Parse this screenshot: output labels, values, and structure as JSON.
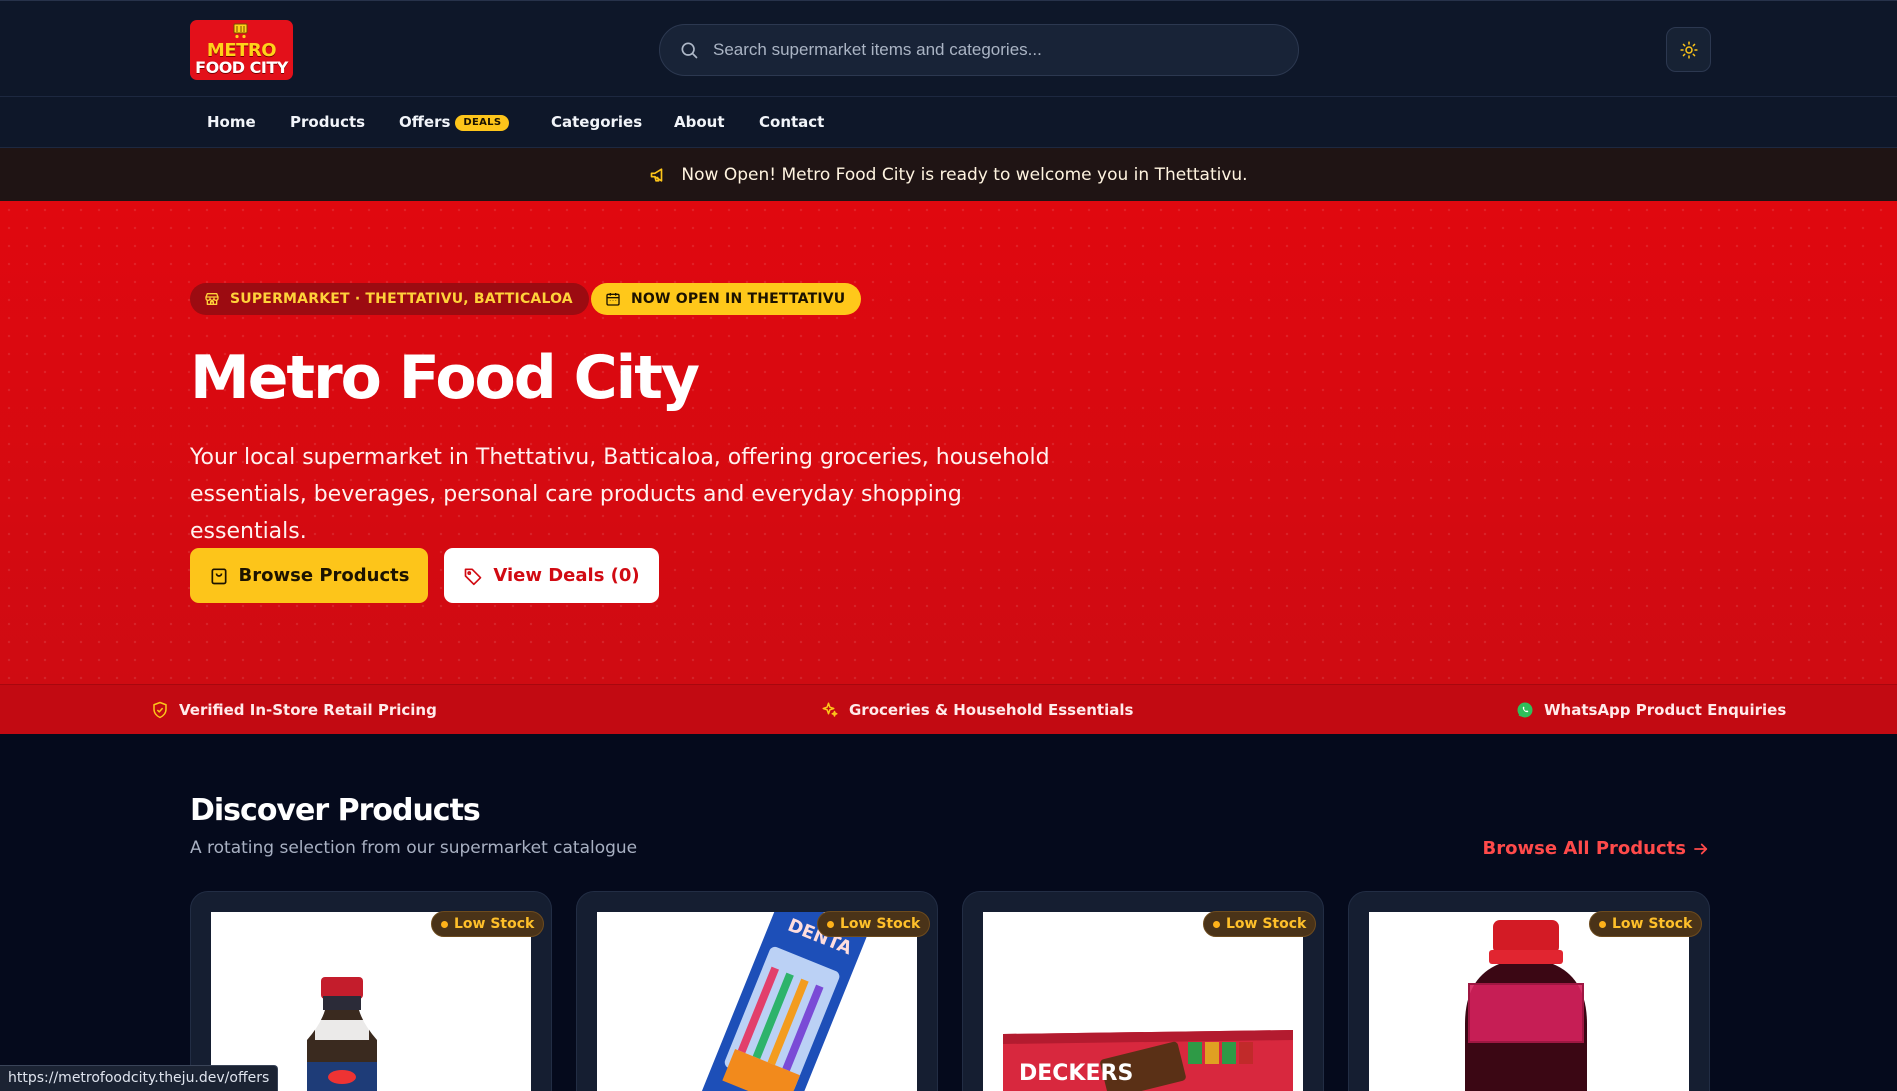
{
  "header": {
    "logo": {
      "line1": "METRO",
      "line2": "FOOD CITY"
    },
    "search": {
      "placeholder": "Search supermarket items and categories..."
    },
    "theme_toggle_icon": "sun-icon"
  },
  "nav": {
    "items": [
      {
        "label": "Home"
      },
      {
        "label": "Products"
      },
      {
        "label": "Offers",
        "badge": "DEALS"
      },
      {
        "label": "Categories"
      },
      {
        "label": "About"
      },
      {
        "label": "Contact"
      }
    ]
  },
  "announcement": {
    "icon": "megaphone-icon",
    "text": "Now Open! Metro Food City is ready to welcome you in Thettativu."
  },
  "hero": {
    "pills": [
      {
        "icon": "store-icon",
        "label": "SUPERMARKET · THETTATIVU, BATTICALOA"
      },
      {
        "icon": "calendar-icon",
        "label": "NOW OPEN IN THETTATIVU"
      }
    ],
    "title": "Metro Food City",
    "description": "Your local supermarket in Thettativu, Batticaloa, offering groceries, household essentials, beverages, personal care products and everyday shopping essentials.",
    "buttons": {
      "browse": "Browse Products",
      "deals": "View Deals (0)"
    }
  },
  "features": [
    {
      "icon": "shield-check-icon",
      "label": "Verified In-Store Retail Pricing"
    },
    {
      "icon": "sparkles-icon",
      "label": "Groceries & Household Essentials"
    },
    {
      "icon": "whatsapp-icon",
      "label": "WhatsApp Product Enquiries"
    }
  ],
  "discover": {
    "title": "Discover Products",
    "subtitle": "A rotating selection from our supermarket catalogue",
    "browse_all": "Browse All Products",
    "cards": [
      {
        "stock": "Low Stock",
        "image": "sauce-bottle"
      },
      {
        "stock": "Low Stock",
        "image": "toothbrush-pack",
        "pack_text": "DENTA"
      },
      {
        "stock": "Low Stock",
        "image": "chocolate-bar",
        "pack_text": "DECKERS"
      },
      {
        "stock": "Low Stock",
        "image": "rose-colour-bottle"
      }
    ]
  },
  "status_url": "https://metrofoodcity.theju.dev/offers",
  "colors": {
    "brand_red": "#e3101a",
    "brand_yellow": "#fdc51a",
    "dark_bg": "#050a1c",
    "header_bg": "#0e1729",
    "accent_link": "#ff4a4a",
    "stock_text": "#ffc02a"
  }
}
